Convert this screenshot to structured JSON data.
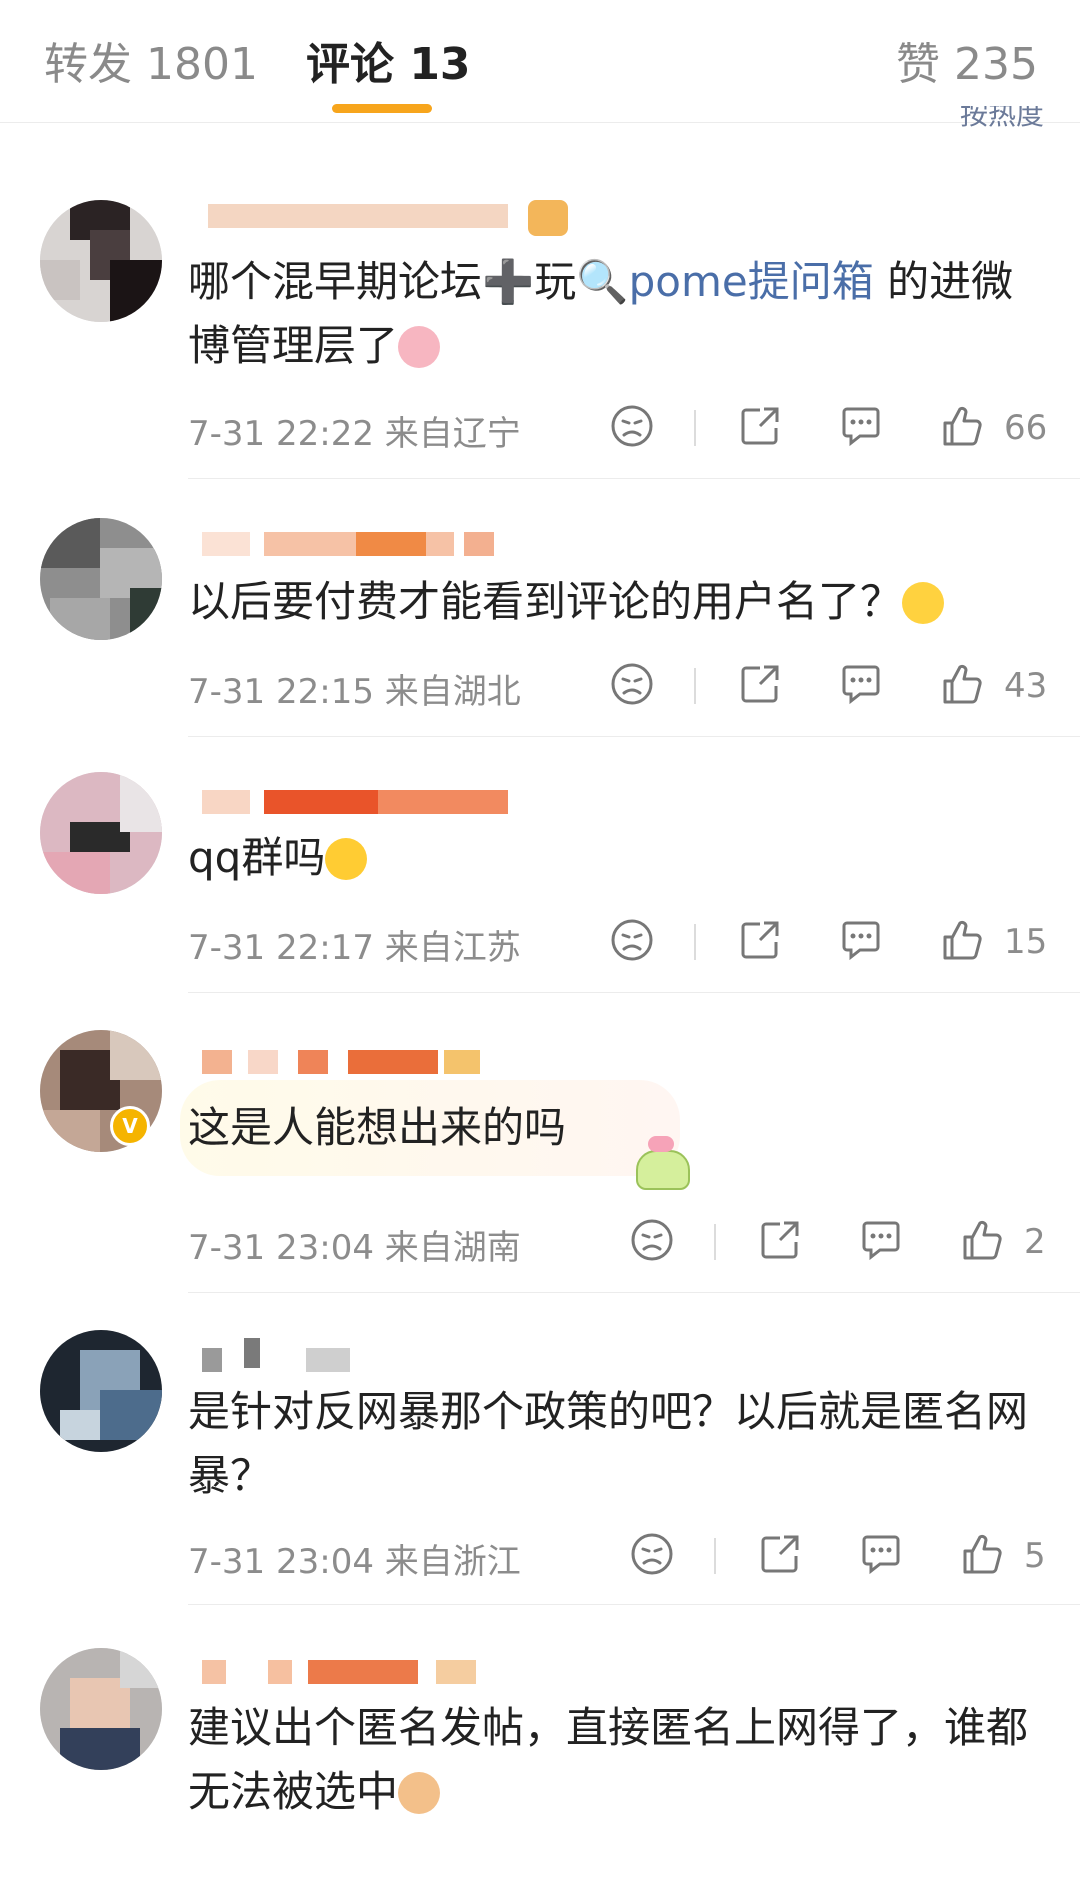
{
  "tabs": {
    "reposts_label": "转发 1801",
    "comments_label": "评论 13",
    "likes_label": "赞 235",
    "sort_hint": "按热度"
  },
  "colors": {
    "accent": "#f7a51c",
    "topic_link": "#4a6ea8",
    "meta": "#8c8c8c"
  },
  "comments": [
    {
      "text_before": "哪个混早期论坛➕玩",
      "topic": "pome提问箱",
      "text_after": " 的进微博管理层了",
      "emoji": "pig-face",
      "time": "7-31 22:22",
      "location": "来自辽宁",
      "likes": "66"
    },
    {
      "text": "以后要付费才能看到评论的用户名了？",
      "emoji": "laughing-crying-face",
      "time": "7-31 22:15",
      "location": "来自湖北",
      "likes": "43"
    },
    {
      "text": "qq群吗",
      "emoji": "thinking-face",
      "time": "7-31 22:17",
      "location": "来自江苏",
      "likes": "15"
    },
    {
      "text": "这是人能想出来的吗",
      "emoji": "pudding-sticker",
      "time": "7-31 23:04",
      "location": "来自湖南",
      "likes": "2",
      "verified": true
    },
    {
      "text": "是针对反网暴那个政策的吧？以后就是匿名网暴？",
      "time": "7-31 23:04",
      "location": "来自浙江",
      "likes": "5"
    },
    {
      "text": "建议出个匿名发帖，直接匿名上网得了，谁都无法被选中",
      "emoji": "shiba-face",
      "time": "",
      "location": "",
      "likes": ""
    }
  ],
  "icons": [
    "dislike-icon",
    "share-icon",
    "reply-icon",
    "like-icon"
  ]
}
